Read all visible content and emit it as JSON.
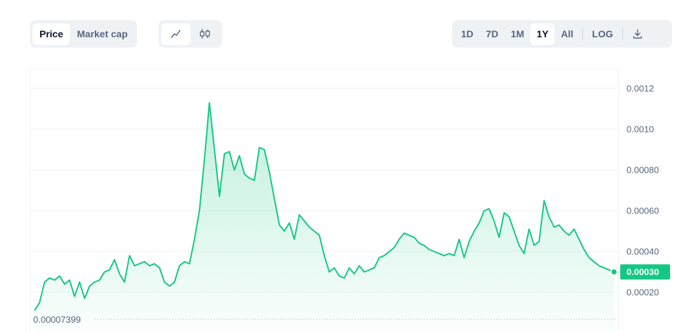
{
  "toolbar": {
    "metric_tabs": [
      {
        "label": "Price",
        "active": true
      },
      {
        "label": "Market cap",
        "active": false
      }
    ],
    "chart_types": [
      {
        "icon": "line-chart-icon",
        "active": true
      },
      {
        "icon": "candlestick-icon",
        "active": false
      }
    ],
    "ranges": [
      {
        "label": "1D",
        "active": false
      },
      {
        "label": "7D",
        "active": false
      },
      {
        "label": "1M",
        "active": false
      },
      {
        "label": "1Y",
        "active": true
      },
      {
        "label": "All",
        "active": false
      }
    ],
    "log_label": "LOG",
    "download_icon": "download-icon"
  },
  "colors": {
    "line": "#16c784",
    "badge": "#16c784",
    "grid": "#eff2f5",
    "axis_text": "#58667e"
  },
  "chart_data": {
    "type": "area",
    "title": "",
    "xlabel": "",
    "ylabel": "",
    "ylim": [
      7.399e-05,
      0.0013
    ],
    "yticks": [
      {
        "value": 0.0012,
        "label": "0.0012"
      },
      {
        "value": 0.001,
        "label": "0.0010"
      },
      {
        "value": 0.0008,
        "label": "0.00080"
      },
      {
        "value": 0.0006,
        "label": "0.00060"
      },
      {
        "value": 0.0004,
        "label": "0.00040"
      },
      {
        "value": 0.0002,
        "label": "0.00020"
      }
    ],
    "grid": true,
    "current_price_label": "0.00030",
    "current_price": 0.0003,
    "low_label": "0.00007399",
    "low_value": 7.399e-05,
    "series": [
      {
        "values": [
          0.00011,
          0.00015,
          0.00025,
          0.00027,
          0.00026,
          0.00028,
          0.00024,
          0.00026,
          0.00018,
          0.00025,
          0.00017,
          0.00023,
          0.00025,
          0.00026,
          0.0003,
          0.00031,
          0.00036,
          0.00029,
          0.00025,
          0.00038,
          0.00033,
          0.00034,
          0.00035,
          0.00033,
          0.00034,
          0.00032,
          0.00025,
          0.00023,
          0.00025,
          0.00033,
          0.00035,
          0.00034,
          0.00046,
          0.0006,
          0.00085,
          0.00113,
          0.0009,
          0.00067,
          0.00088,
          0.00089,
          0.0008,
          0.00087,
          0.00078,
          0.00076,
          0.00075,
          0.00091,
          0.0009,
          0.00079,
          0.00066,
          0.00053,
          0.0005,
          0.00054,
          0.00046,
          0.00058,
          0.00055,
          0.00052,
          0.0005,
          0.00048,
          0.00038,
          0.0003,
          0.00032,
          0.00028,
          0.00027,
          0.00032,
          0.00029,
          0.00033,
          0.0003,
          0.00031,
          0.00032,
          0.00037,
          0.00038,
          0.0004,
          0.00042,
          0.00046,
          0.00049,
          0.00048,
          0.00047,
          0.00044,
          0.00043,
          0.00041,
          0.0004,
          0.00039,
          0.00038,
          0.00039,
          0.00038,
          0.00046,
          0.00037,
          0.00045,
          0.0005,
          0.00054,
          0.0006,
          0.00061,
          0.00055,
          0.00047,
          0.00059,
          0.00057,
          0.0005,
          0.00043,
          0.00039,
          0.00051,
          0.00043,
          0.00045,
          0.00065,
          0.00057,
          0.00052,
          0.00053,
          0.0005,
          0.00048,
          0.00051,
          0.00046,
          0.00041,
          0.00037,
          0.00035,
          0.00033,
          0.00032,
          0.00031,
          0.0003
        ]
      }
    ]
  }
}
